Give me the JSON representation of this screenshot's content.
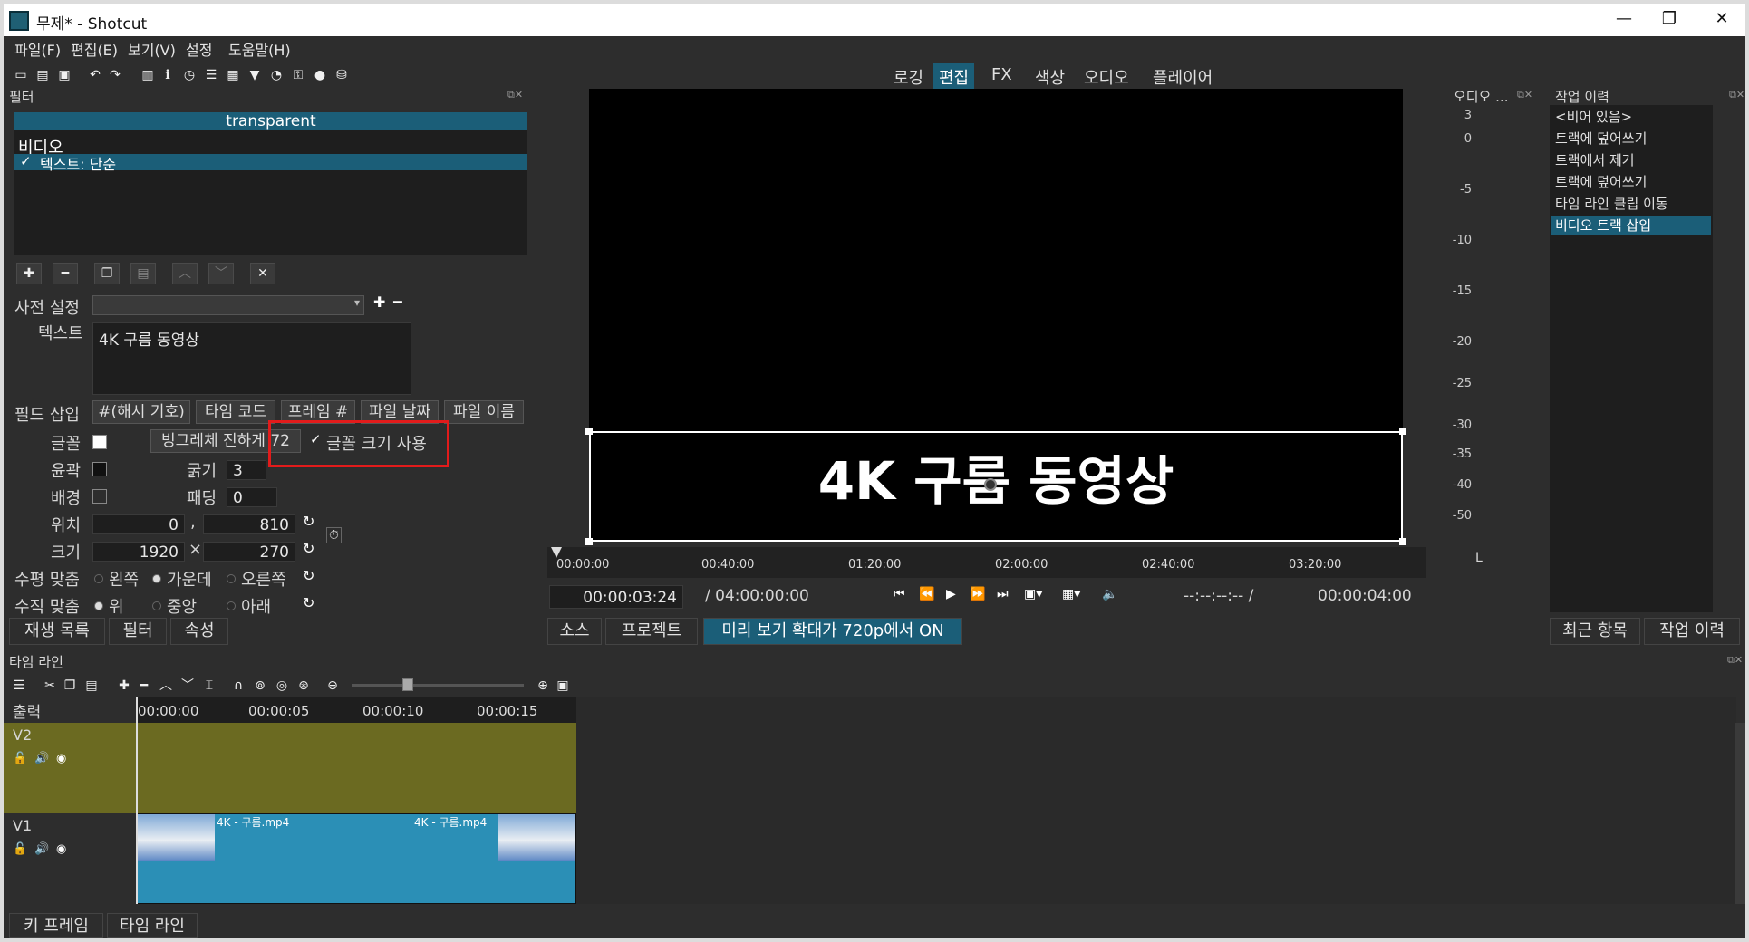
{
  "window": {
    "title": "무제* - Shotcut",
    "minimize": "—",
    "maximize": "❐",
    "close": "✕"
  },
  "menu": [
    "파일(F)",
    "편집(E)",
    "보기(V)",
    "설정",
    "도움말(H)"
  ],
  "modes": [
    {
      "label": "로깅",
      "active": false
    },
    {
      "label": "편집",
      "active": true
    },
    {
      "label": "FX",
      "active": false
    },
    {
      "label": "색상",
      "active": false
    },
    {
      "label": "오디오",
      "active": false
    },
    {
      "label": "플레이어",
      "active": false
    }
  ],
  "filter_panel": {
    "title": "필터",
    "clip_name": "transparent",
    "group_label": "비디오",
    "filter_item": "텍스트: 단순",
    "preset_label": "사전 설정",
    "text_label": "텍스트",
    "text_value": "4K 구름 동영상",
    "insert_field_label": "필드 삽입",
    "insert_chips": [
      "#(해시 기호)",
      "타임 코드",
      "프레임 #",
      "파일 날짜",
      "파일 이름"
    ],
    "font_label": "글꼴",
    "font_name": "빙그레체 진하게 72",
    "font_size_checkbox": "글꼴 크기 사용",
    "outline_label": "윤곽",
    "thickness_label": "굵기",
    "thickness_value": "3",
    "background_label": "배경",
    "padding_label": "패딩",
    "padding_value": "0",
    "position_label": "위치",
    "position_x": "0",
    "position_y": "810",
    "size_label": "크기",
    "size_w": "1920",
    "size_h": "270",
    "halign_label": "수평 맞춤",
    "halign_options": [
      "왼쪽",
      "가운데",
      "오른쪽"
    ],
    "valign_label": "수직 맞춤",
    "valign_options": [
      "위",
      "중앙",
      "아래"
    ],
    "bottom_tabs": [
      "재생 목록",
      "필터",
      "속성"
    ]
  },
  "preview": {
    "overlay_text": "4K 구름 동영상",
    "ruler": [
      "00:00:00",
      "00:40:00",
      "01:20:00",
      "02:00:00",
      "02:40:00",
      "03:20:00"
    ],
    "timecode": "00:00:03:24",
    "duration": "/ 04:00:00:00",
    "in_out": "--:--:--:-- /",
    "end_time": "00:00:04:00",
    "tabs": [
      "소스",
      "프로젝트",
      "미리 보기 확대가 720p에서 ON"
    ]
  },
  "audio_meter": {
    "title": "오디오 ...",
    "ticks": [
      "3",
      "0",
      "-5",
      "-10",
      "-15",
      "-20",
      "-25",
      "-30",
      "-35",
      "-40",
      "-50"
    ],
    "channel": "L"
  },
  "history": {
    "title": "작업 이력",
    "items": [
      "<비어 있음>",
      "트랙에 덮어쓰기",
      "트랙에서 제거",
      "트랙에 덮어쓰기",
      "타임 라인 클립 이동",
      "비디오 트랙 삽입"
    ],
    "selected_index": 5,
    "tabs": [
      "최근 항목",
      "작업 이력"
    ]
  },
  "timeline": {
    "title": "타임 라인",
    "output_label": "출력",
    "ruler": [
      "00:00:00",
      "00:00:05",
      "00:00:10",
      "00:00:15"
    ],
    "tracks": [
      {
        "name": "V2",
        "color": "#6b6a21"
      },
      {
        "name": "V1",
        "color": "#2b8fb6"
      }
    ],
    "clips": [
      "4K - 구름.mp4",
      "4K - 구름.mp4"
    ],
    "bottom_tabs": [
      "키 프레임",
      "타임 라인"
    ]
  },
  "colors": {
    "accent": "#1b5e78",
    "highlight_box": "#e21b1b"
  }
}
